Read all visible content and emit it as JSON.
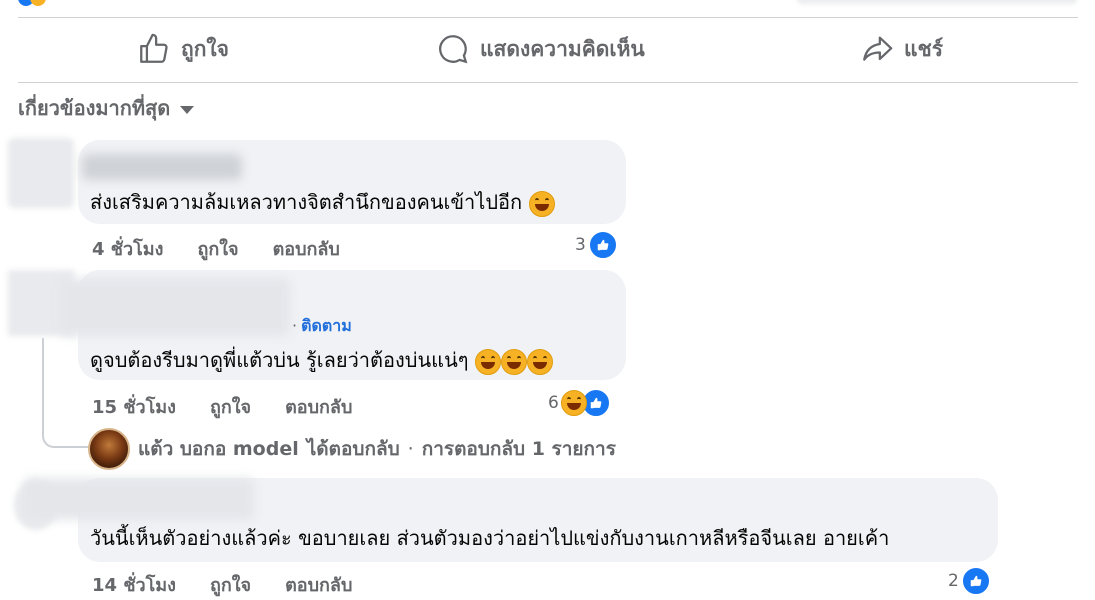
{
  "actions": {
    "like": "ถูกใจ",
    "comment": "แสดงความคิดเห็น",
    "share": "แชร์"
  },
  "filter": {
    "label": "เกี่ยวข้องมากที่สุด"
  },
  "comments": [
    {
      "text": "ส่งเสริมความล้มเหลวทางจิตสำนึกของคนเข้าไปอีก",
      "time": "4 ชั่วโมง",
      "like": "ถูกใจ",
      "reply": "ตอบกลับ",
      "reaction_count": "3"
    },
    {
      "follow": "ติดตาม",
      "text": "ดูจบต้องรีบมาดูพี่แต้วบ่น รู้เลยว่าต้องบ่นแน่ๆ",
      "time": "15 ชั่วโมง",
      "like": "ถูกใจ",
      "reply": "ตอบกลับ",
      "reaction_count": "6",
      "reply_summary": {
        "author": "แต้ว บอกอ model",
        "action": "ได้ตอบกลับ",
        "separator": "·",
        "count": "การตอบกลับ 1 รายการ"
      }
    },
    {
      "text": "วันนี้เห็นตัวอย่างแล้วค่ะ ขอบายเลย ส่วนตัวมองว่าอย่าไปแข่งกับงานเกาหลีหรือจีนเลย อายเค้า",
      "time": "14 ชั่วโมง",
      "like": "ถูกใจ",
      "reply": "ตอบกลับ",
      "reaction_count": "2"
    }
  ],
  "colors": {
    "accent": "#1877f2",
    "link": "#216fdb",
    "secondary_text": "#65676b",
    "bubble": "#f0f2f5"
  }
}
